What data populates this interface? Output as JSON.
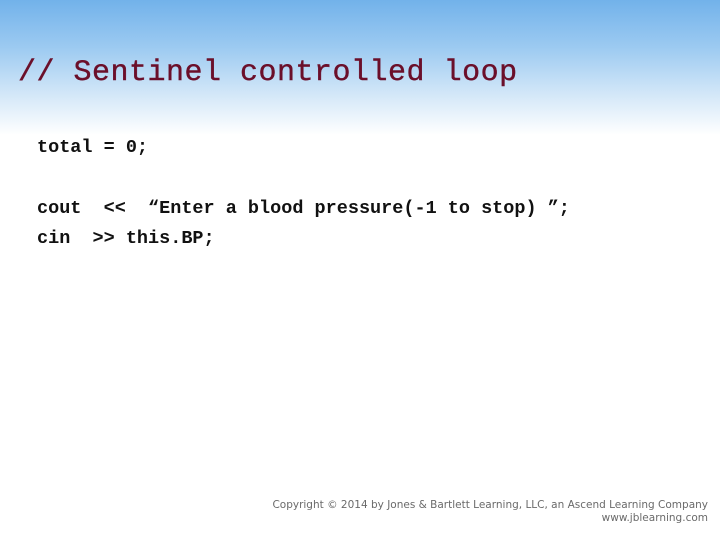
{
  "slide": {
    "title": "// Sentinel controlled loop",
    "code_lines": [
      "total = 0;",
      "cout  <<  “Enter a blood pressure(-1 to stop) ”;",
      "cin  >> this.BP;"
    ]
  },
  "footer": {
    "copyright": "Copyright © 2014 by Jones & Bartlett Learning, LLC, an Ascend Learning Company",
    "website": "www.jblearning.com"
  },
  "colors": {
    "title": "#6b0f2a",
    "header_gradient_top": "#72b2ea",
    "header_gradient_bottom": "#ffffff",
    "code_text": "#111111"
  }
}
